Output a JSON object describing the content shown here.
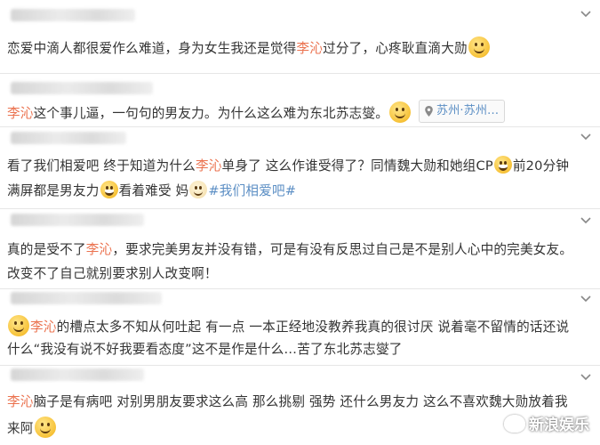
{
  "comments": [
    {
      "name_color": "#eb7350",
      "parts": {
        "a": "恋爱中滴人都很爱作么难道，身为女生我还是觉得",
        "name": "李沁",
        "b": "过分了，心疼耿直滴大勋"
      },
      "emoji": "smile-icon"
    },
    {
      "parts": {
        "name": "李沁",
        "a": "这个事儿逼，一句句的男友力。为什么这么难为东北苏志燮。"
      },
      "emoji": "smile-icon",
      "location": "苏州·苏州..."
    },
    {
      "line1": {
        "a": "看了我们相爱吧  终于知道为什么",
        "name": "李沁",
        "b": "单身了 这么作谁受得了？同情魏大勋和她组CP",
        "c": "前20分钟"
      },
      "line2": {
        "a": "满屏都是男友力",
        "b": "看着难受 妈",
        "tag": "#我们相爱吧#"
      }
    },
    {
      "line1": {
        "a": "真的是受不了",
        "name": "李沁",
        "b": "，要求完美男友并没有错，可是有没有反思过自己是不是别人心中的完美女友。"
      },
      "line2": "改变不了自己就别要求别人改变啊！"
    },
    {
      "line1": {
        "name": "李沁",
        "a": "的槽点太多不知从何吐起 有一点 一本正经地没教养我真的很讨厌 说着毫不留情的话还说"
      },
      "line2": "什么“我没有说不好我要看态度”这不是作是什么…苦了东北苏志燮了"
    },
    {
      "line1": {
        "name": "李沁",
        "a": "脑子是有病吧 对别男朋友要求这么高 那么挑剔 强势 还什么男友力 这么不喜欢魏大勋放着我"
      },
      "line2": "来阿"
    }
  ],
  "watermark": "新浪娱乐",
  "icons": {
    "more": "chevron-down-icon",
    "location": "location-pin-icon",
    "logo": "weibo-logo-icon"
  }
}
